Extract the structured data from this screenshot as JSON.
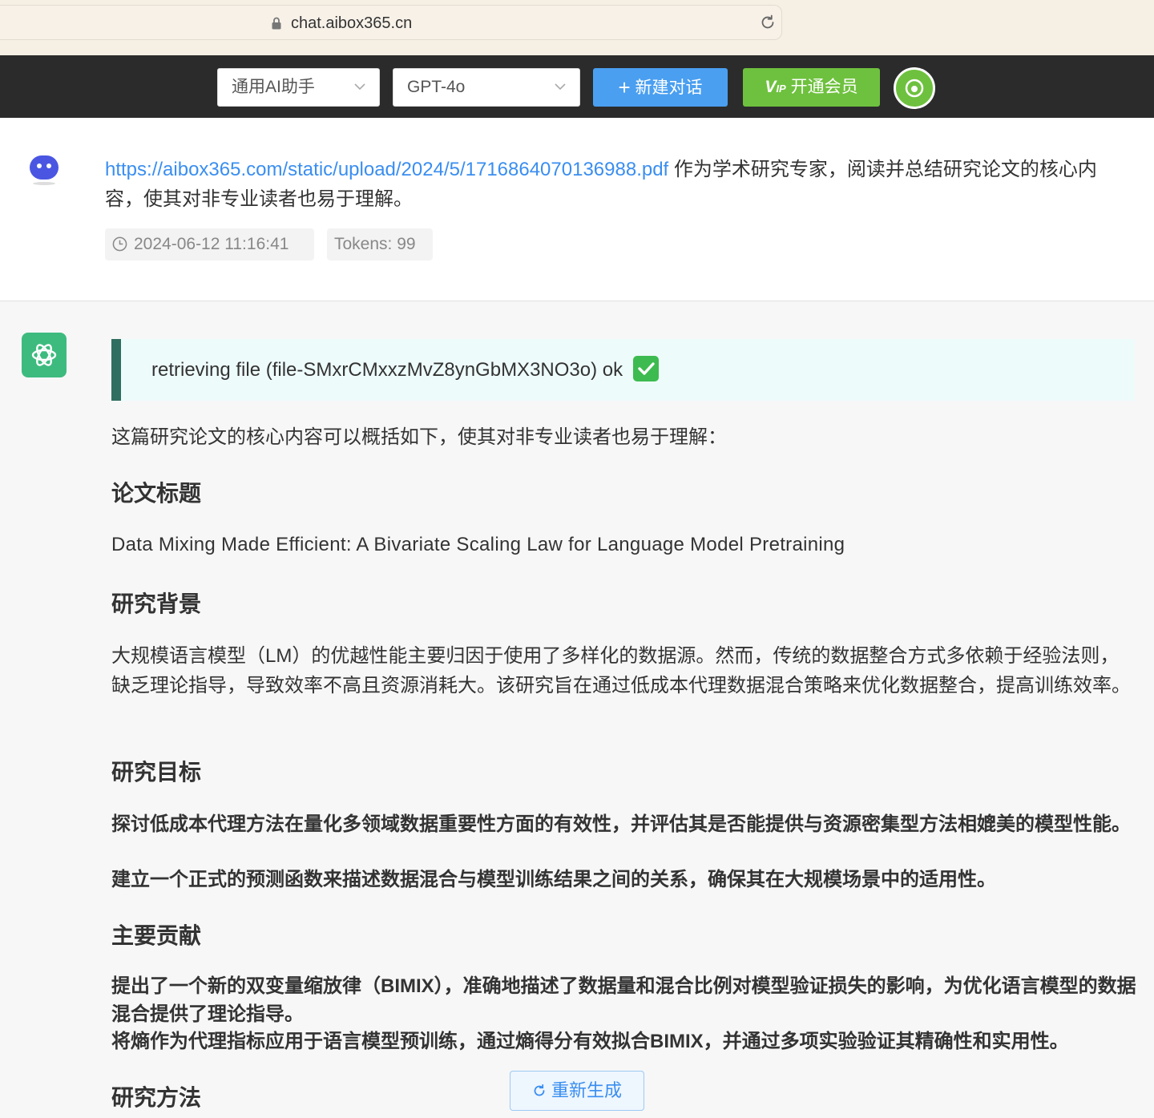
{
  "browser": {
    "url": "chat.aibox365.cn"
  },
  "toolbar": {
    "assistant_select": "通用AI助手",
    "model_select": "GPT-4o",
    "new_chat_label": "新建对话",
    "vip_label": "开通会员"
  },
  "user_message": {
    "link": "https://aibox365.com/static/upload/2024/5/1716864070136988.pdf",
    "text": " 作为学术研究专家，阅读并总结研究论文的核心内容，使其对非专业读者也易于理解。",
    "timestamp": "2024-06-12 11:16:41",
    "tokens": "Tokens: 99"
  },
  "ai_message": {
    "retrieval": "retrieving file (file-SMxrCMxxzMvZ8ynGbMX3NO3o) ok",
    "intro": "这篇研究论文的核心内容可以概括如下，使其对非专业读者也易于理解：",
    "h_title": "论文标题",
    "paper_title": "Data Mixing Made Efficient: A Bivariate Scaling Law for Language Model Pretraining",
    "h_background": "研究背景",
    "background": "大规模语言模型（LM）的优越性能主要归因于使用了多样化的数据源。然而，传统的数据整合方式多依赖于经验法则，缺乏理论指导，导致效率不高且资源消耗大。该研究旨在通过低成本代理数据混合策略来优化数据整合，提高训练效率。",
    "h_goal": "研究目标",
    "goal_1": "探讨低成本代理方法在量化多领域数据重要性方面的有效性，并评估其是否能提供与资源密集型方法相媲美的模型性能。",
    "goal_2": "建立一个正式的预测函数来描述数据混合与模型训练结果之间的关系，确保其在大规模场景中的适用性。",
    "h_contrib": "主要贡献",
    "contrib_1": "提出了一个新的双变量缩放律（BIMIX），准确地描述了数据量和混合比例对模型验证损失的影响，为优化语言模型的数据混合提供了理论指导。",
    "contrib_2": "将熵作为代理指标应用于语言模型预训练，通过熵得分有效拟合BIMIX，并通过多项实验验证其精确性和实用性。",
    "h_method": "研究方法",
    "regenerate_label": "重新生成"
  }
}
